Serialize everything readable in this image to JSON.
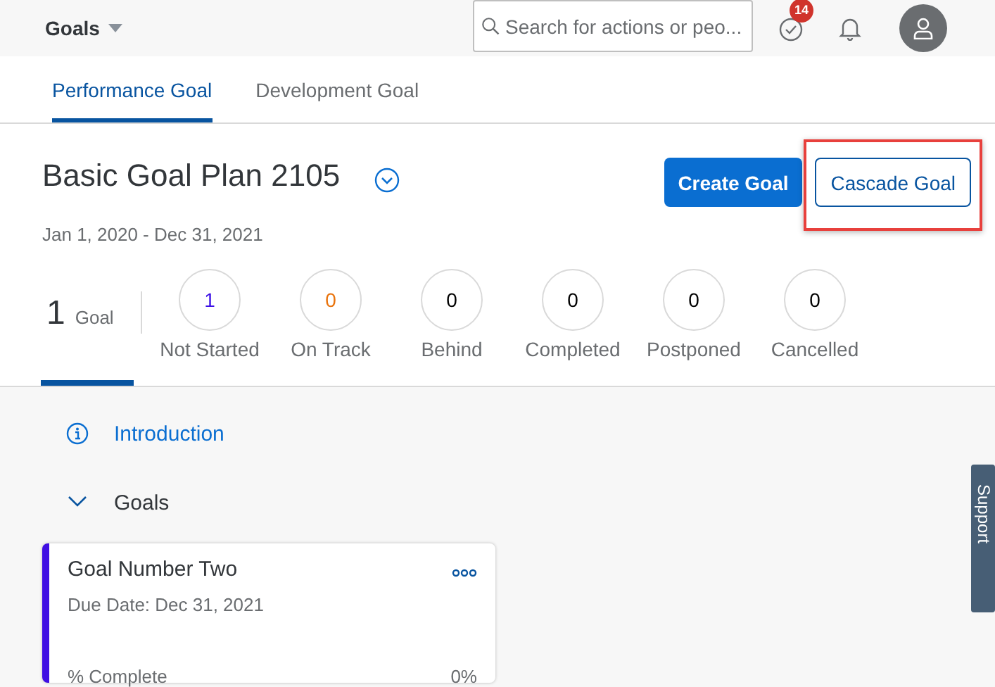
{
  "header": {
    "title": "Goals",
    "search": {
      "placeholder": "Search for actions or peo..."
    },
    "notification_badge": "14"
  },
  "tabs": [
    {
      "label": "Performance Goal",
      "selected": true
    },
    {
      "label": "Development Goal",
      "selected": false
    }
  ],
  "plan": {
    "title": "Basic Goal Plan 2105",
    "date_range": "Jan 1, 2020 - Dec 31, 2021",
    "buttons": [
      {
        "label": "Create Goal",
        "kind": "primary",
        "highlighted": false
      },
      {
        "label": "Cascade Goal",
        "kind": "secondary",
        "highlighted": true
      }
    ]
  },
  "summary": {
    "count": "1",
    "label": "Goal",
    "selected": true
  },
  "statuses": [
    {
      "count": "1",
      "label": "Not Started",
      "color": "#3c10e6"
    },
    {
      "count": "0",
      "label": "On Track",
      "color": "#e9730c"
    },
    {
      "count": "0",
      "label": "Behind",
      "color": "#000000"
    },
    {
      "count": "0",
      "label": "Completed",
      "color": "#000000"
    },
    {
      "count": "0",
      "label": "Postponed",
      "color": "#000000"
    },
    {
      "count": "0",
      "label": "Cancelled",
      "color": "#000000"
    }
  ],
  "sections": [
    {
      "kind": "info",
      "label": "Introduction"
    },
    {
      "kind": "group",
      "label": "Goals",
      "expanded": true
    }
  ],
  "goal_cards": [
    {
      "title": "Goal Number Two",
      "due_date": "Due Date: Dec 31, 2021",
      "progress_label": "% Complete",
      "progress_value": "0%",
      "color": "#3f0fe3"
    }
  ],
  "support_tab": "Support"
}
